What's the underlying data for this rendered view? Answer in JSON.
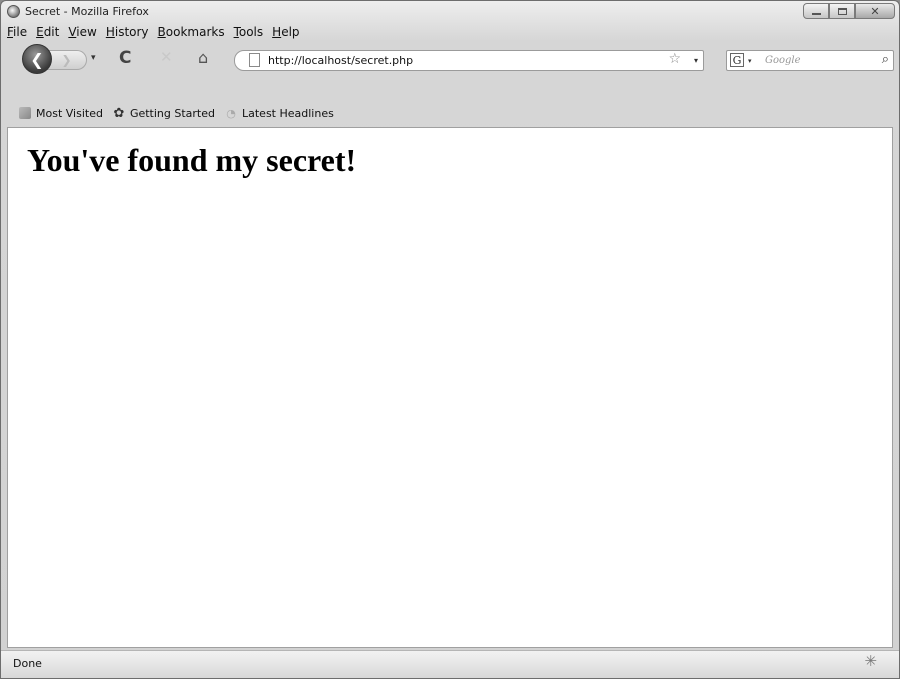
{
  "window": {
    "title": "Secret - Mozilla Firefox",
    "controls": {
      "minimize": "minimize",
      "maximize": "maximize",
      "close": "✕"
    }
  },
  "menubar": {
    "items": [
      {
        "label": "File"
      },
      {
        "label": "Edit"
      },
      {
        "label": "View"
      },
      {
        "label": "History"
      },
      {
        "label": "Bookmarks"
      },
      {
        "label": "Tools"
      },
      {
        "label": "Help"
      }
    ]
  },
  "navbar": {
    "back_glyph": "❮",
    "forward_glyph": "❯",
    "dropdown_glyph": "▾",
    "reload_glyph": "C",
    "stop_glyph": "✕",
    "home_glyph": "⌂",
    "url": "http://localhost/secret.php",
    "bookmark_star_glyph": "☆",
    "search": {
      "engine_glyph": "G",
      "placeholder": "Google",
      "search_glyph": "⌕"
    }
  },
  "bookmarks_toolbar": {
    "items": [
      {
        "label": "Most Visited",
        "icon": "most-visited-icon"
      },
      {
        "label": "Getting Started",
        "icon": "getting-started-icon"
      },
      {
        "label": "Latest Headlines",
        "icon": "rss-feed-icon"
      }
    ]
  },
  "page": {
    "heading": "You've found my secret!"
  },
  "statusbar": {
    "text": "Done",
    "sparkle_glyph": "✳"
  }
}
